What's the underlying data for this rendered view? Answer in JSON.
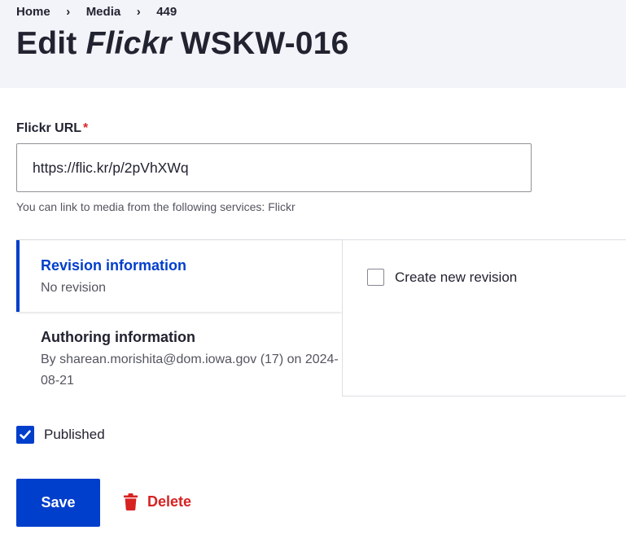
{
  "breadcrumb": {
    "items": [
      "Home",
      "Media",
      "449"
    ],
    "separator": "›"
  },
  "page": {
    "title_prefix": "Edit ",
    "title_italic": "Flickr",
    "title_suffix": " WSKW-016"
  },
  "url_field": {
    "label": "Flickr URL",
    "required_marker": "*",
    "value": "https://flic.kr/p/2pVhXWq",
    "description": "You can link to media from the following services: Flickr"
  },
  "vertical_tabs": {
    "revision": {
      "title": "Revision information",
      "summary": "No revision"
    },
    "authoring": {
      "title": "Authoring information",
      "summary": "By sharean.morishita@dom.iowa.gov (17) on 2024-08-21"
    },
    "pane": {
      "create_revision_label": "Create new revision"
    }
  },
  "published": {
    "label": "Published",
    "checked": true
  },
  "actions": {
    "save_label": "Save",
    "delete_label": "Delete"
  },
  "colors": {
    "accent": "#003ecc",
    "danger": "#d72222",
    "header_bg": "#f3f4f9"
  },
  "icons": {
    "breadcrumb_separator": "chevron-right-icon",
    "delete": "trash-icon",
    "checkmark": "checkmark-icon"
  }
}
